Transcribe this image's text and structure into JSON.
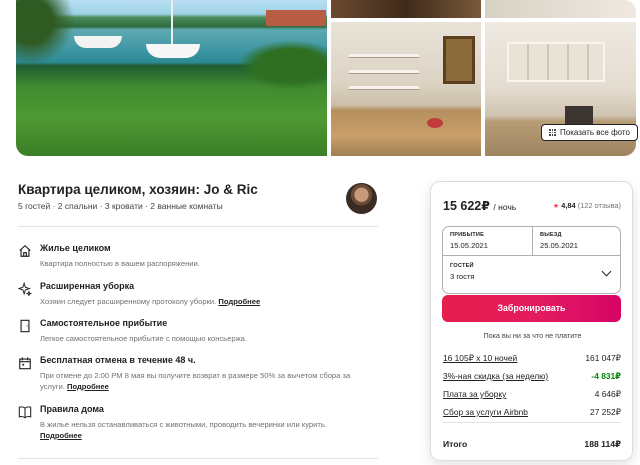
{
  "gallery": {
    "show_all_label": "Показать все фото"
  },
  "listing": {
    "title": "Квартира целиком, хозяин: Jo & Ric",
    "subtitle": "5 гостей · 2 спальни · 3 кровати · 2 ванные комнаты"
  },
  "features": [
    {
      "icon": "home-icon",
      "title": "Жилье целиком",
      "desc": "Квартира полностью в вашем распоряжении.",
      "link": ""
    },
    {
      "icon": "sparkles-icon",
      "title": "Расширенная уборка",
      "desc": "Хозяин следует расширенному протоколу уборки.",
      "link": "Подробнее"
    },
    {
      "icon": "door-icon",
      "title": "Самостоятельное прибытие",
      "desc": "Легкое самостоятельное прибытие с помощью консьержа.",
      "link": ""
    },
    {
      "icon": "calendar-icon",
      "title": "Бесплатная отмена в течение 48 ч.",
      "desc": "При отмене до 2:00 PM 8 мая вы получите возврат в размере 50% за вычетом сбора за услуги.",
      "link": "Подробнее"
    },
    {
      "icon": "book-icon",
      "title": "Правила дома",
      "desc": "В жилье нельзя останавливаться с животными, проводить вечеринки или курить.",
      "link": "Подробнее"
    }
  ],
  "booking": {
    "price": "15 622₽",
    "per_night": "/ ночь",
    "rating": "4,84",
    "reviews": "(122 отзыва)",
    "checkin_label": "ПРИБЫТИЕ",
    "checkin_value": "15.05.2021",
    "checkout_label": "ВЫЕЗД",
    "checkout_value": "25.05.2021",
    "guests_label": "ГОСТЕЙ",
    "guests_value": "3 гостя",
    "book_button": "Забронировать",
    "no_charge": "Пока вы ни за что не платите",
    "lines": [
      {
        "label": "16 105₽ x 10 ночей",
        "amount": "161 047₽",
        "green": false
      },
      {
        "label": "3%-ная скидка (за неделю)",
        "amount": "-4 831₽",
        "green": true
      },
      {
        "label": "Плата за уборку",
        "amount": "4 646₽",
        "green": false
      },
      {
        "label": "Сбор за услуги Airbnb",
        "amount": "27 252₽",
        "green": false
      }
    ],
    "total_label": "Итого",
    "total_amount": "188 114₽"
  },
  "colors": {
    "accent": "#e31c5f",
    "discount": "#008a05",
    "text": "#222222",
    "muted": "#717171"
  }
}
